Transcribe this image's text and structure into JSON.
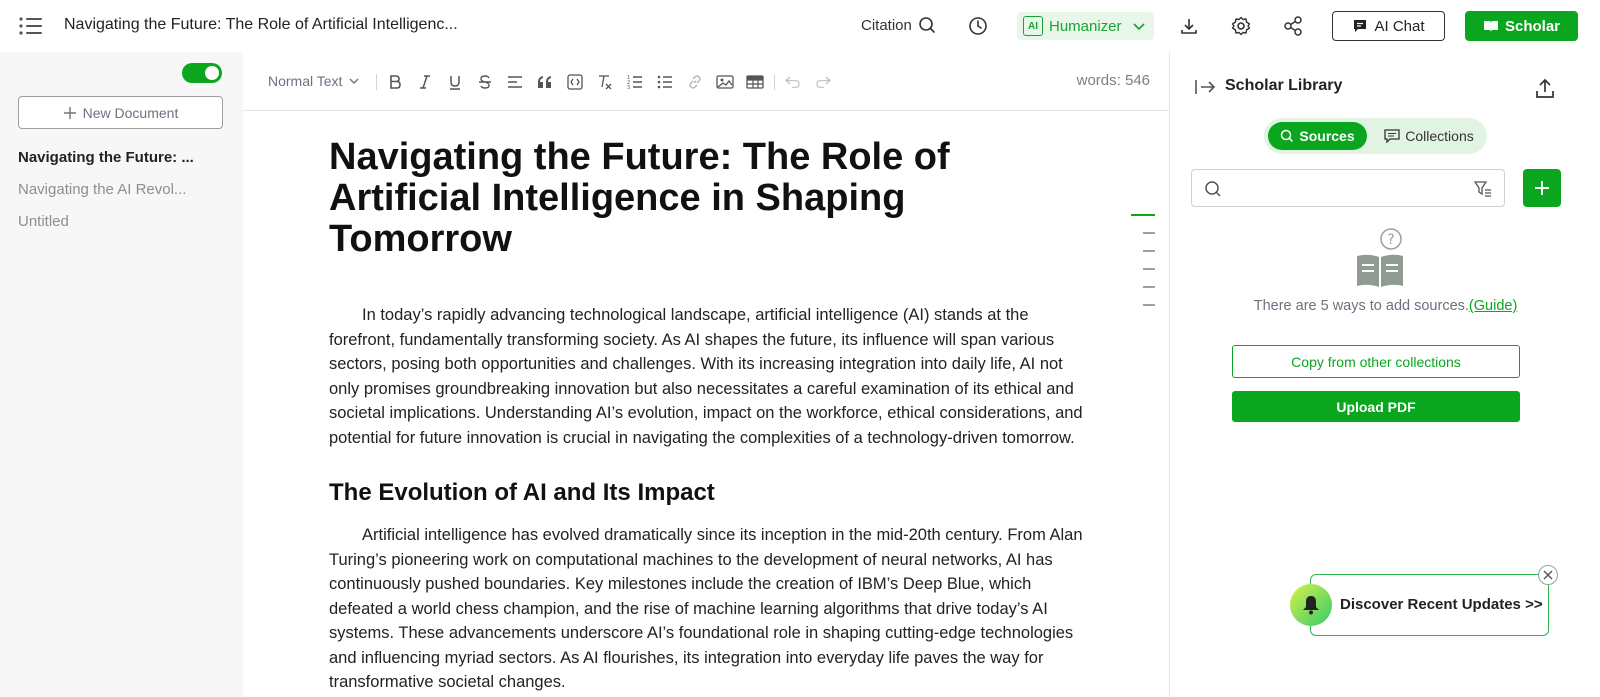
{
  "topbar": {
    "document_title": "Navigating the Future: The Role of Artificial Intelligenc...",
    "citation_label": "Citation",
    "humanizer_badge": "AI",
    "humanizer_label": "Humanizer",
    "ai_chat_label": "AI Chat",
    "scholar_label": "Scholar"
  },
  "sidebar": {
    "new_document_label": "New Document",
    "documents": [
      {
        "title": "Navigating the Future: ...",
        "active": true
      },
      {
        "title": "Navigating the AI Revol...",
        "active": false
      },
      {
        "title": "Untitled",
        "active": false
      }
    ]
  },
  "editor": {
    "text_style": "Normal Text",
    "word_count": "words: 546",
    "heading": "Navigating the Future: The Role of Artificial Intelligence in Shaping Tomorrow",
    "intro_paragraph": "In today’s rapidly advancing technological landscape, artificial intelligence (AI) stands at the forefront, fundamentally transforming society. As AI shapes the future, its influence will span various sectors, posing both opportunities and challenges. With its increasing integration into daily life, AI not only promises groundbreaking innovation but also necessitates a careful examination of its ethical and societal implications. Understanding AI’s evolution, impact on the workforce, ethical considerations, and potential for future innovation is crucial in navigating the complexities of a technology-driven tomorrow.",
    "section_heading": "The Evolution of AI and Its Impact",
    "section_paragraph": "Artificial intelligence has evolved dramatically since its inception in the mid-20th century. From Alan Turing’s pioneering work on computational machines to the development of neural networks, AI has continuously pushed boundaries. Key milestones include the creation of IBM’s Deep Blue, which defeated a world chess champion, and the rise of machine learning algorithms that drive today’s AI systems. These advancements underscore AI’s foundational role in shaping cutting-edge technologies and influencing myriad sectors. As AI flourishes, its integration into everyday life paves the way for transformative societal changes."
  },
  "scholar_panel": {
    "title": "Scholar Library",
    "tab_sources": "Sources",
    "tab_collections": "Collections",
    "search_placeholder": "",
    "empty_message": "There are 5 ways to add sources.",
    "guide_link": "(Guide)",
    "copy_button": "Copy from other collections",
    "upload_button": "Upload PDF"
  },
  "updates_popup": {
    "label": "Discover Recent Updates >>"
  },
  "colors": {
    "accent": "#0aa61e",
    "accent_light": "#e1f3e3"
  }
}
